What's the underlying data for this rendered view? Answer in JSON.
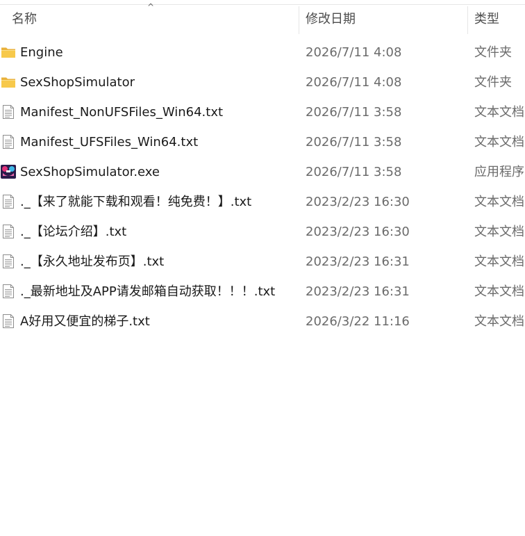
{
  "header": {
    "col_name": "名称",
    "col_date": "修改日期",
    "col_type": "类型",
    "sort_indicator": "^"
  },
  "rows": [
    {
      "icon": "folder-icon",
      "name": "Engine",
      "date": "2026/7/11 4:08",
      "type": "文件夹"
    },
    {
      "icon": "folder-icon",
      "name": "SexShopSimulator",
      "date": "2026/7/11 4:08",
      "type": "文件夹"
    },
    {
      "icon": "text-file-icon",
      "name": "Manifest_NonUFSFiles_Win64.txt",
      "date": "2026/7/11 3:58",
      "type": "文本文档"
    },
    {
      "icon": "text-file-icon",
      "name": "Manifest_UFSFiles_Win64.txt",
      "date": "2026/7/11 3:58",
      "type": "文本文档"
    },
    {
      "icon": "app-icon",
      "name": "SexShopSimulator.exe",
      "date": "2026/7/11 3:58",
      "type": "应用程序"
    },
    {
      "icon": "text-file-icon",
      "name": "._【来了就能下载和观看！纯免费！】.txt",
      "date": "2023/2/23 16:30",
      "type": "文本文档"
    },
    {
      "icon": "text-file-icon",
      "name": "._【论坛介绍】.txt",
      "date": "2023/2/23 16:30",
      "type": "文本文档"
    },
    {
      "icon": "text-file-icon",
      "name": "._【永久地址发布页】.txt",
      "date": "2023/2/23 16:31",
      "type": "文本文档"
    },
    {
      "icon": "text-file-icon",
      "name": "._最新地址及APP请发邮箱自动获取！！！.txt",
      "date": "2023/2/23 16:31",
      "type": "文本文档"
    },
    {
      "icon": "text-file-icon",
      "name": "A好用又便宜的梯子.txt",
      "date": "2026/3/22 11:16",
      "type": "文本文档"
    }
  ]
}
